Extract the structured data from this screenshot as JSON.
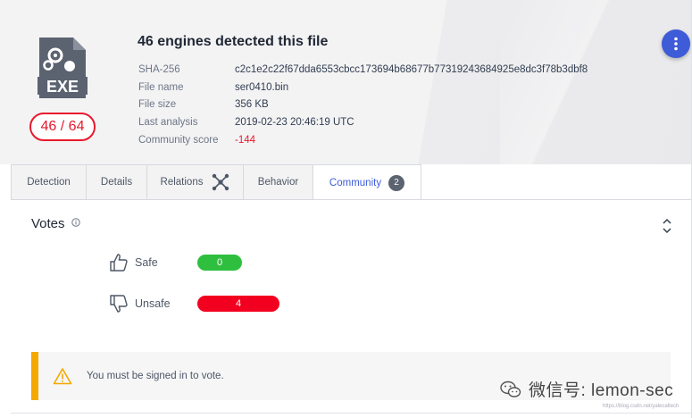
{
  "file": {
    "icon_label": "EXE",
    "title": "46 engines detected this file",
    "score": "46 / 64",
    "meta": [
      {
        "key": "SHA-256",
        "value": "c2c1e2c22f67dda6553cbcc173694b68677b77319243684925e8dc3f78b3dbf8",
        "highlight": false
      },
      {
        "key": "File name",
        "value": "ser0410.bin",
        "highlight": false
      },
      {
        "key": "File size",
        "value": "356 KB",
        "highlight": false
      },
      {
        "key": "Last analysis",
        "value": "2019-02-23 20:46:19 UTC",
        "highlight": false
      },
      {
        "key": "Community score",
        "value": "-144",
        "highlight": true
      }
    ]
  },
  "tabs": [
    {
      "label": "Detection"
    },
    {
      "label": "Details"
    },
    {
      "label": "Relations"
    },
    {
      "label": "Behavior"
    },
    {
      "label": "Community",
      "badge": "2",
      "active": true
    }
  ],
  "votes": {
    "title": "Votes",
    "safe": {
      "label": "Safe",
      "count": "0"
    },
    "unsafe": {
      "label": "Unsafe",
      "count": "4"
    }
  },
  "notice": {
    "text": "You must be signed in to vote."
  },
  "watermark": {
    "text": "微信号: lemon-sec",
    "url": "https://blog.csdn.net/yalecaltech"
  },
  "colors": {
    "accent": "#3e5bd8",
    "danger": "#e8192c",
    "safe": "#2fbf3f",
    "unsafe": "#f2001f",
    "warning": "#f4a800"
  }
}
